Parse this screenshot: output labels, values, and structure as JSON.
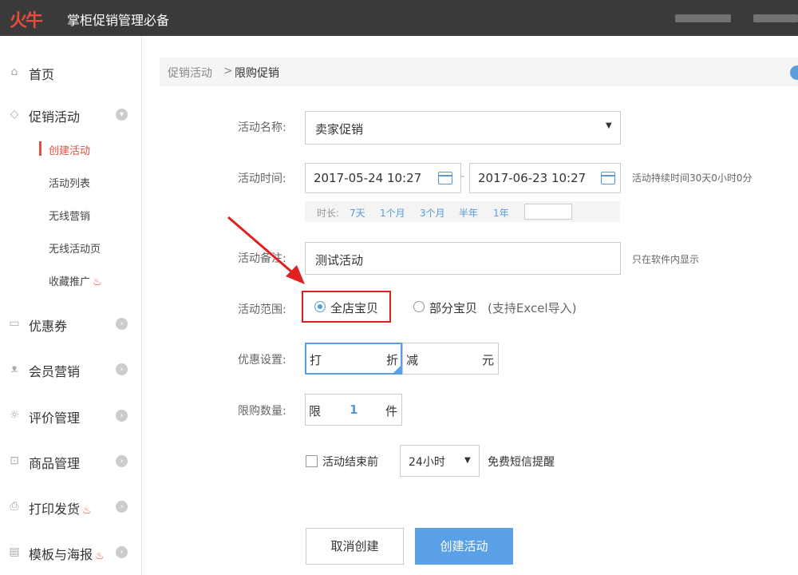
{
  "header": {
    "logo": "火牛",
    "title": "掌柜促销管理必备"
  },
  "sidebar": {
    "home": "首页",
    "promo": "促销活动",
    "promo_sub": [
      "创建活动",
      "活动列表",
      "无线营销",
      "无线活动页",
      "收藏推广"
    ],
    "coupon": "优惠券",
    "member": "会员营销",
    "review": "评价管理",
    "goods": "商品管理",
    "print": "打印发货",
    "template": "模板与海报"
  },
  "breadcrumb": {
    "parent": "促销活动",
    "sep": ">",
    "current": "限购促销"
  },
  "form": {
    "name_label": "活动名称:",
    "name_value": "卖家促销",
    "time_label": "活动时间:",
    "start": "2017-05-24 10:27",
    "dash": "-",
    "end": "2017-06-23 10:27",
    "duration": "活动持续时间30天0小时0分",
    "quick_label": "时长:",
    "quick": [
      "7天",
      "1个月",
      "3个月",
      "半年",
      "1年"
    ],
    "note_label": "活动备注:",
    "note_value": "测试活动",
    "note_hint": "只在软件内显示",
    "scope_label": "活动范围:",
    "scope_all": "全店宝贝",
    "scope_part": "部分宝贝",
    "scope_part_hint": "(支持Excel导入)",
    "discount_label": "优惠设置:",
    "dz_prefix": "打",
    "dz_suffix": "折",
    "minus_prefix": "减",
    "minus_suffix": "元",
    "limit_label": "限购数量:",
    "limit_prefix": "限",
    "limit_value": "1",
    "limit_suffix": "件",
    "remind_label": "活动结束前",
    "remind_value": "24小时",
    "remind_suffix": "免费短信提醒",
    "cancel": "取消创建",
    "create": "创建活动"
  },
  "colors": {
    "accent": "#5aa0e6",
    "brand": "#e84c3d",
    "highlight": "#e02020"
  }
}
